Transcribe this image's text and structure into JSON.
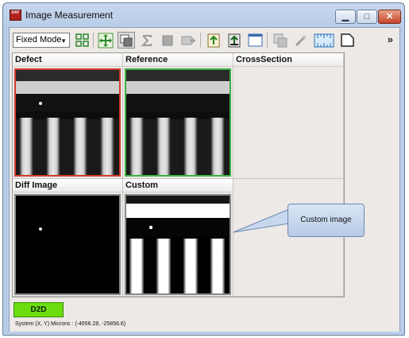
{
  "window": {
    "title": "Image Measurement",
    "icon_text": "DAT"
  },
  "toolbar": {
    "mode_select_value": "Fixed Mode",
    "icons": [
      "grid-layout-icon",
      "zoom-fit-icon",
      "overlay-icon",
      "sum-icon",
      "square-icon",
      "export-icon",
      "upload-icon",
      "upload-alt-icon",
      "window-icon",
      "copy-icon",
      "wand-icon",
      "ruler-icon",
      "shape-icon"
    ],
    "more_label": "»"
  },
  "panes": [
    {
      "label": "Defect"
    },
    {
      "label": "Reference"
    },
    {
      "label": "CrossSection"
    },
    {
      "label": "Diff Image"
    },
    {
      "label": "Custom"
    },
    {
      "label": ""
    }
  ],
  "callout": {
    "text": "Custom image"
  },
  "status": {
    "d2d_label": "D2D",
    "coordinates": "System (X, Y) Microns : (-4656.28, -25856.6)"
  },
  "colors": {
    "defect_border": "#d23a2e",
    "reference_border": "#3cb043",
    "d2d_button": "#6cde10"
  }
}
